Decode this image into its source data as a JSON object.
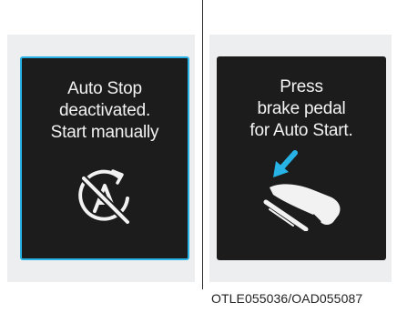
{
  "colors": {
    "screen_background": "#1c1c1c",
    "active_border": "#27b3e6",
    "arrow_accent": "#27b3e6",
    "panel_background": "#eceeef",
    "text": "#f2f2f2"
  },
  "left_panel": {
    "message_lines": [
      "Auto Stop",
      "deactivated.",
      "Start manually"
    ],
    "icon": "auto-stop-off-icon"
  },
  "right_panel": {
    "message_lines": [
      "Press",
      "brake pedal",
      "for Auto Start."
    ],
    "icon": "brake-pedal-press-icon"
  },
  "caption": "OTLE055036/OAD055087"
}
